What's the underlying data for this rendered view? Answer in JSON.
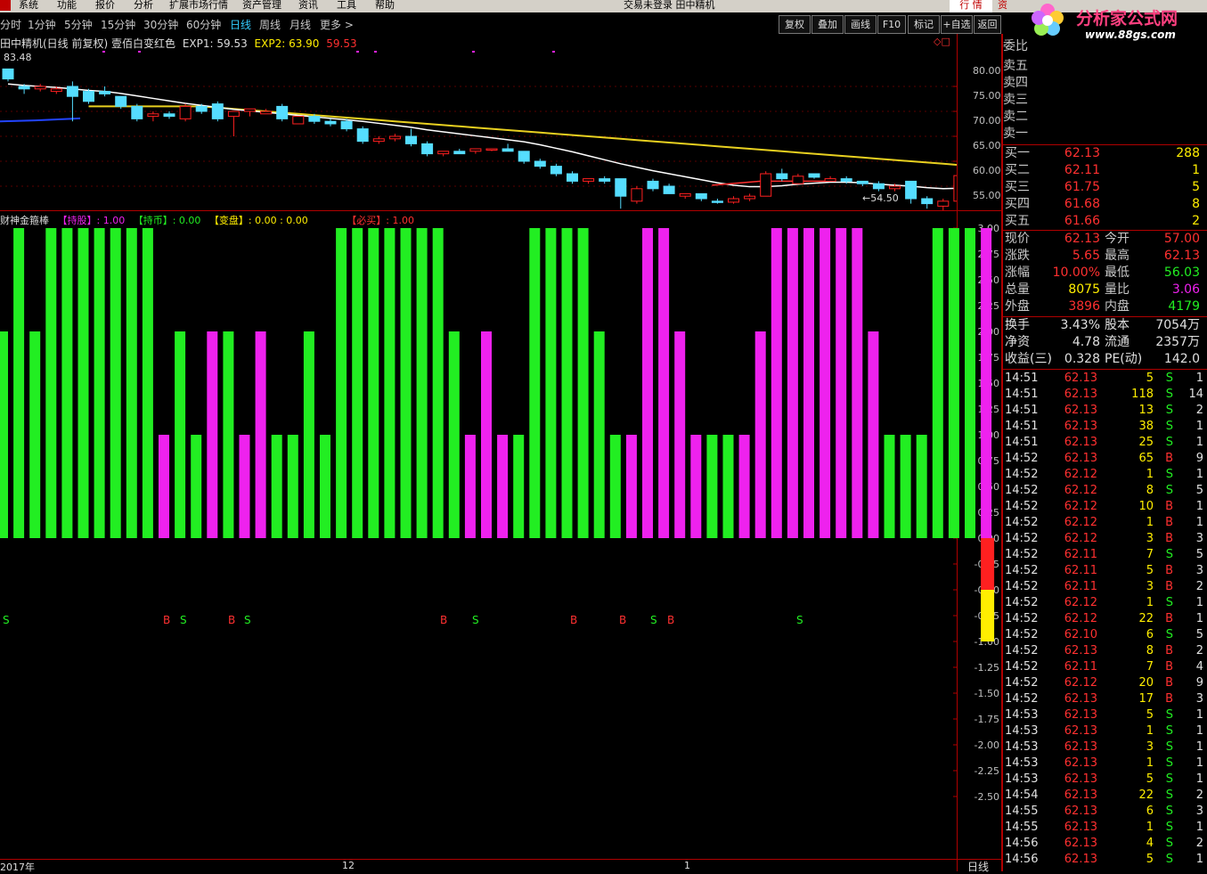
{
  "menu": [
    "系统",
    "功能",
    "报价",
    "分析",
    "扩展市场行情",
    "资产管理",
    "资讯",
    "工具",
    "帮助"
  ],
  "window_title": "交易未登录   田中精机",
  "tabs_right": [
    "行 情",
    "资"
  ],
  "logo": {
    "text": "分析家公式网",
    "url": "www.88gs.com"
  },
  "periods": [
    "分时",
    "1分钟",
    "5分钟",
    "15分钟",
    "30分钟",
    "60分钟",
    "日线",
    "周线",
    "月线",
    "更多 >"
  ],
  "active_period": "日线",
  "toolbar_buttons": [
    "复权",
    "叠加",
    "画线",
    "F10",
    "标记",
    "+自选",
    "返回"
  ],
  "main_chart": {
    "title": "田中精机(日线 前复权) 壹佰白变红色",
    "exp1_label": "EXP1: 59.53",
    "exp2_label": "EXP2: 63.90",
    "extra": "59.53",
    "high_label": "83.48",
    "low_label": "54.50",
    "axis_ticks": [
      "80.00",
      "75.00",
      "70.00",
      "65.00",
      "60.00",
      "55.00"
    ]
  },
  "indicator": {
    "title": "财神金箍棒",
    "hold_stock": "【持股】: 1.00",
    "hold_cash": "【持币】: 0.00",
    "change": "【变盘】: 0.00 : 0.00",
    "must_buy": "【必买】: 1.00",
    "axis_ticks": [
      "3.00",
      "2.75",
      "2.50",
      "2.25",
      "2.00",
      "1.75",
      "1.50",
      "1.25",
      "1.00",
      "0.75",
      "0.50",
      "0.25",
      "0.00",
      "-0.25",
      "-0.50",
      "-0.75",
      "-1.00",
      "-1.25",
      "-1.50",
      "-1.75",
      "-2.00",
      "-2.25",
      "-2.50"
    ],
    "bs_marks": [
      [
        "S",
        3
      ],
      [
        "B",
        183
      ],
      [
        "S",
        202
      ],
      [
        "B",
        256
      ],
      [
        "S",
        274
      ],
      [
        "B",
        494
      ],
      [
        "S",
        530
      ],
      [
        "B",
        640
      ],
      [
        "B",
        695
      ],
      [
        "S",
        730
      ],
      [
        "B",
        749
      ],
      [
        "S",
        894
      ]
    ]
  },
  "bottom_axis": {
    "labels": [
      "2017年",
      "12",
      "1"
    ],
    "period_label": "日线"
  },
  "colors": {
    "green": "#22ee22",
    "magenta": "#ee22ee",
    "yellow": "#ffee00",
    "red": "#ff2020",
    "cyan": "#55ddff",
    "axis": "#b00000"
  },
  "quote": {
    "weibi_label": "委比",
    "sells": [
      "卖五",
      "卖四",
      "卖三",
      "卖二",
      "卖一"
    ],
    "buys": [
      [
        "买一",
        "62.13",
        "288"
      ],
      [
        "买二",
        "62.11",
        "1"
      ],
      [
        "买三",
        "61.75",
        "5"
      ],
      [
        "买四",
        "61.68",
        "8"
      ],
      [
        "买五",
        "61.66",
        "2"
      ]
    ],
    "stats": [
      [
        "现价",
        "62.13",
        "今开",
        "57.00"
      ],
      [
        "涨跌",
        "5.65",
        "最高",
        "62.13"
      ],
      [
        "涨幅",
        "10.00%",
        "最低",
        "56.03"
      ],
      [
        "总量",
        "8075",
        "量比",
        "3.06"
      ],
      [
        "外盘",
        "3896",
        "内盘",
        "4179"
      ]
    ],
    "stats2": [
      [
        "换手",
        "3.43%",
        "股本",
        "7054万"
      ],
      [
        "净资",
        "4.78",
        "流通",
        "2357万"
      ],
      [
        "收益(三)",
        "0.328",
        "PE(动)",
        "142.0"
      ]
    ],
    "ticks": [
      [
        "14:51",
        "62.13",
        "5",
        "S",
        "1"
      ],
      [
        "14:51",
        "62.13",
        "118",
        "S",
        "14"
      ],
      [
        "14:51",
        "62.13",
        "13",
        "S",
        "2"
      ],
      [
        "14:51",
        "62.13",
        "38",
        "S",
        "1"
      ],
      [
        "14:51",
        "62.13",
        "25",
        "S",
        "1"
      ],
      [
        "14:52",
        "62.13",
        "65",
        "B",
        "9"
      ],
      [
        "14:52",
        "62.12",
        "1",
        "S",
        "1"
      ],
      [
        "14:52",
        "62.12",
        "8",
        "S",
        "5"
      ],
      [
        "14:52",
        "62.12",
        "10",
        "B",
        "1"
      ],
      [
        "14:52",
        "62.12",
        "1",
        "B",
        "1"
      ],
      [
        "14:52",
        "62.12",
        "3",
        "B",
        "3"
      ],
      [
        "14:52",
        "62.11",
        "7",
        "S",
        "5"
      ],
      [
        "14:52",
        "62.11",
        "5",
        "B",
        "3"
      ],
      [
        "14:52",
        "62.11",
        "3",
        "B",
        "2"
      ],
      [
        "14:52",
        "62.12",
        "1",
        "S",
        "1"
      ],
      [
        "14:52",
        "62.12",
        "22",
        "B",
        "1"
      ],
      [
        "14:52",
        "62.10",
        "6",
        "S",
        "5"
      ],
      [
        "14:52",
        "62.13",
        "8",
        "B",
        "2"
      ],
      [
        "14:52",
        "62.11",
        "7",
        "B",
        "4"
      ],
      [
        "14:52",
        "62.12",
        "20",
        "B",
        "9"
      ],
      [
        "14:52",
        "62.13",
        "17",
        "B",
        "3"
      ],
      [
        "14:53",
        "62.13",
        "5",
        "S",
        "1"
      ],
      [
        "14:53",
        "62.13",
        "1",
        "S",
        "1"
      ],
      [
        "14:53",
        "62.13",
        "3",
        "S",
        "1"
      ],
      [
        "14:53",
        "62.13",
        "1",
        "S",
        "1"
      ],
      [
        "14:53",
        "62.13",
        "5",
        "S",
        "1"
      ],
      [
        "14:54",
        "62.13",
        "22",
        "S",
        "2"
      ],
      [
        "14:55",
        "62.13",
        "6",
        "S",
        "3"
      ],
      [
        "14:55",
        "62.13",
        "1",
        "S",
        "1"
      ],
      [
        "14:56",
        "62.13",
        "4",
        "S",
        "2"
      ],
      [
        "14:56",
        "62.13",
        "5",
        "S",
        "1"
      ]
    ]
  },
  "chart_data": {
    "type": "bar",
    "candles": [
      {
        "o": 83.5,
        "h": 83.5,
        "l": 81.0,
        "c": 81.5
      },
      {
        "o": 80.0,
        "h": 80.5,
        "l": 78.5,
        "c": 79.5
      },
      {
        "o": 79.5,
        "h": 80.5,
        "l": 79.0,
        "c": 80.0
      },
      {
        "o": 79.0,
        "h": 80.0,
        "l": 78.5,
        "c": 79.5
      },
      {
        "o": 80.0,
        "h": 81.0,
        "l": 73.0,
        "c": 78.0
      },
      {
        "o": 79.0,
        "h": 79.5,
        "l": 76.5,
        "c": 77.0
      },
      {
        "o": 79.0,
        "h": 80.0,
        "l": 78.0,
        "c": 78.5
      },
      {
        "o": 78.0,
        "h": 78.0,
        "l": 75.5,
        "c": 76.0
      },
      {
        "o": 76.0,
        "h": 76.5,
        "l": 73.0,
        "c": 73.5
      },
      {
        "o": 74.0,
        "h": 75.0,
        "l": 73.0,
        "c": 74.5
      },
      {
        "o": 74.5,
        "h": 75.0,
        "l": 73.5,
        "c": 74.0
      },
      {
        "o": 73.5,
        "h": 76.5,
        "l": 73.0,
        "c": 76.0
      },
      {
        "o": 76.0,
        "h": 76.5,
        "l": 74.5,
        "c": 75.0
      },
      {
        "o": 76.5,
        "h": 77.0,
        "l": 73.0,
        "c": 73.5
      },
      {
        "o": 74.0,
        "h": 75.0,
        "l": 70.0,
        "c": 75.0
      },
      {
        "o": 75.0,
        "h": 75.5,
        "l": 74.0,
        "c": 75.5
      },
      {
        "o": 74.5,
        "h": 75.5,
        "l": 74.5,
        "c": 75.0
      },
      {
        "o": 76.0,
        "h": 76.5,
        "l": 73.0,
        "c": 73.5
      },
      {
        "o": 72.5,
        "h": 74.0,
        "l": 72.5,
        "c": 74.0
      },
      {
        "o": 74.0,
        "h": 74.5,
        "l": 72.5,
        "c": 73.0
      },
      {
        "o": 73.0,
        "h": 73.5,
        "l": 72.0,
        "c": 72.5
      },
      {
        "o": 73.0,
        "h": 73.5,
        "l": 71.0,
        "c": 71.5
      },
      {
        "o": 71.5,
        "h": 72.0,
        "l": 68.5,
        "c": 69.0
      },
      {
        "o": 69.0,
        "h": 70.0,
        "l": 68.5,
        "c": 69.5
      },
      {
        "o": 69.5,
        "h": 70.5,
        "l": 69.0,
        "c": 70.0
      },
      {
        "o": 70.0,
        "h": 71.5,
        "l": 68.0,
        "c": 68.5
      },
      {
        "o": 68.5,
        "h": 69.0,
        "l": 66.0,
        "c": 66.5
      },
      {
        "o": 66.5,
        "h": 67.0,
        "l": 66.0,
        "c": 67.0
      },
      {
        "o": 67.0,
        "h": 67.5,
        "l": 66.5,
        "c": 66.5
      },
      {
        "o": 67.0,
        "h": 67.5,
        "l": 66.5,
        "c": 67.5
      },
      {
        "o": 67.5,
        "h": 67.5,
        "l": 67.0,
        "c": 67.5
      },
      {
        "o": 67.5,
        "h": 68.5,
        "l": 67.0,
        "c": 67.0
      },
      {
        "o": 67.0,
        "h": 67.0,
        "l": 64.5,
        "c": 65.0
      },
      {
        "o": 65.0,
        "h": 65.5,
        "l": 63.5,
        "c": 64.0
      },
      {
        "o": 64.0,
        "h": 64.5,
        "l": 62.0,
        "c": 62.5
      },
      {
        "o": 62.5,
        "h": 63.0,
        "l": 60.5,
        "c": 61.0
      },
      {
        "o": 61.0,
        "h": 61.5,
        "l": 60.5,
        "c": 61.5
      },
      {
        "o": 61.5,
        "h": 62.0,
        "l": 60.5,
        "c": 61.0
      },
      {
        "o": 61.5,
        "h": 61.5,
        "l": 55.5,
        "c": 58.0
      },
      {
        "o": 57.0,
        "h": 60.0,
        "l": 56.5,
        "c": 59.5
      },
      {
        "o": 61.0,
        "h": 61.5,
        "l": 59.0,
        "c": 59.5
      },
      {
        "o": 60.0,
        "h": 60.5,
        "l": 58.5,
        "c": 58.5
      },
      {
        "o": 58.0,
        "h": 58.5,
        "l": 57.5,
        "c": 58.5
      },
      {
        "o": 58.5,
        "h": 58.5,
        "l": 57.0,
        "c": 57.5
      },
      {
        "o": 57.0,
        "h": 57.5,
        "l": 56.5,
        "c": 56.8
      },
      {
        "o": 56.8,
        "h": 58.0,
        "l": 56.5,
        "c": 57.5
      },
      {
        "o": 57.5,
        "h": 58.5,
        "l": 57.0,
        "c": 58.0
      },
      {
        "o": 58.0,
        "h": 63.0,
        "l": 58.0,
        "c": 62.5
      },
      {
        "o": 62.5,
        "h": 63.5,
        "l": 61.0,
        "c": 61.5
      },
      {
        "o": 60.5,
        "h": 62.5,
        "l": 60.5,
        "c": 62.0
      },
      {
        "o": 62.5,
        "h": 62.5,
        "l": 61.5,
        "c": 61.8
      },
      {
        "o": 61.0,
        "h": 62.0,
        "l": 61.0,
        "c": 61.5
      },
      {
        "o": 61.5,
        "h": 62.0,
        "l": 60.5,
        "c": 61.0
      },
      {
        "o": 61.0,
        "h": 61.0,
        "l": 60.0,
        "c": 60.5
      },
      {
        "o": 60.5,
        "h": 61.0,
        "l": 59.0,
        "c": 59.5
      },
      {
        "o": 59.5,
        "h": 60.5,
        "l": 59.0,
        "c": 60.0
      },
      {
        "o": 61.0,
        "h": 61.0,
        "l": 56.5,
        "c": 57.5
      },
      {
        "o": 57.5,
        "h": 58.0,
        "l": 55.5,
        "c": 56.5
      },
      {
        "o": 56.0,
        "h": 57.5,
        "l": 54.5,
        "c": 57.0
      },
      {
        "o": 57.0,
        "h": 62.5,
        "l": 56.5,
        "c": 62.13
      }
    ],
    "ma_white": [
      80.5,
      80.2,
      80.0,
      79.8,
      79.5,
      79.2,
      79.0,
      78.6,
      78.1,
      77.6,
      77.1,
      76.6,
      76.2,
      75.8,
      75.4,
      75.1,
      74.8,
      74.5,
      74.2,
      73.9,
      73.6,
      73.3,
      73.0,
      72.6,
      72.2,
      71.8,
      71.3,
      70.9,
      70.5,
      70.1,
      69.7,
      69.3,
      68.9,
      68.3,
      67.6,
      66.9,
      66.1,
      65.3,
      64.5,
      63.8,
      63.1,
      62.5,
      61.9,
      61.3,
      60.7,
      60.2,
      59.9,
      59.9,
      60.1,
      60.4,
      60.6,
      60.8,
      60.8,
      60.7,
      60.4,
      60.2,
      60.0,
      59.7,
      59.5,
      59.6,
      59.8
    ],
    "bars": [
      2,
      3,
      2,
      3,
      3,
      3,
      3,
      3,
      3,
      3,
      -1,
      2,
      1,
      -2,
      2,
      -1,
      -2,
      1,
      1,
      2,
      1,
      3,
      3,
      3,
      3,
      3,
      3,
      3,
      2,
      -1,
      -2,
      -1,
      1,
      3,
      3,
      3,
      3,
      2,
      1,
      -1,
      -3,
      -3,
      -2,
      -1,
      1,
      1,
      -1,
      -2,
      -3,
      -3,
      -3,
      -3,
      -3,
      -3,
      -2,
      1,
      1,
      1,
      3,
      3,
      3,
      -9
    ]
  }
}
